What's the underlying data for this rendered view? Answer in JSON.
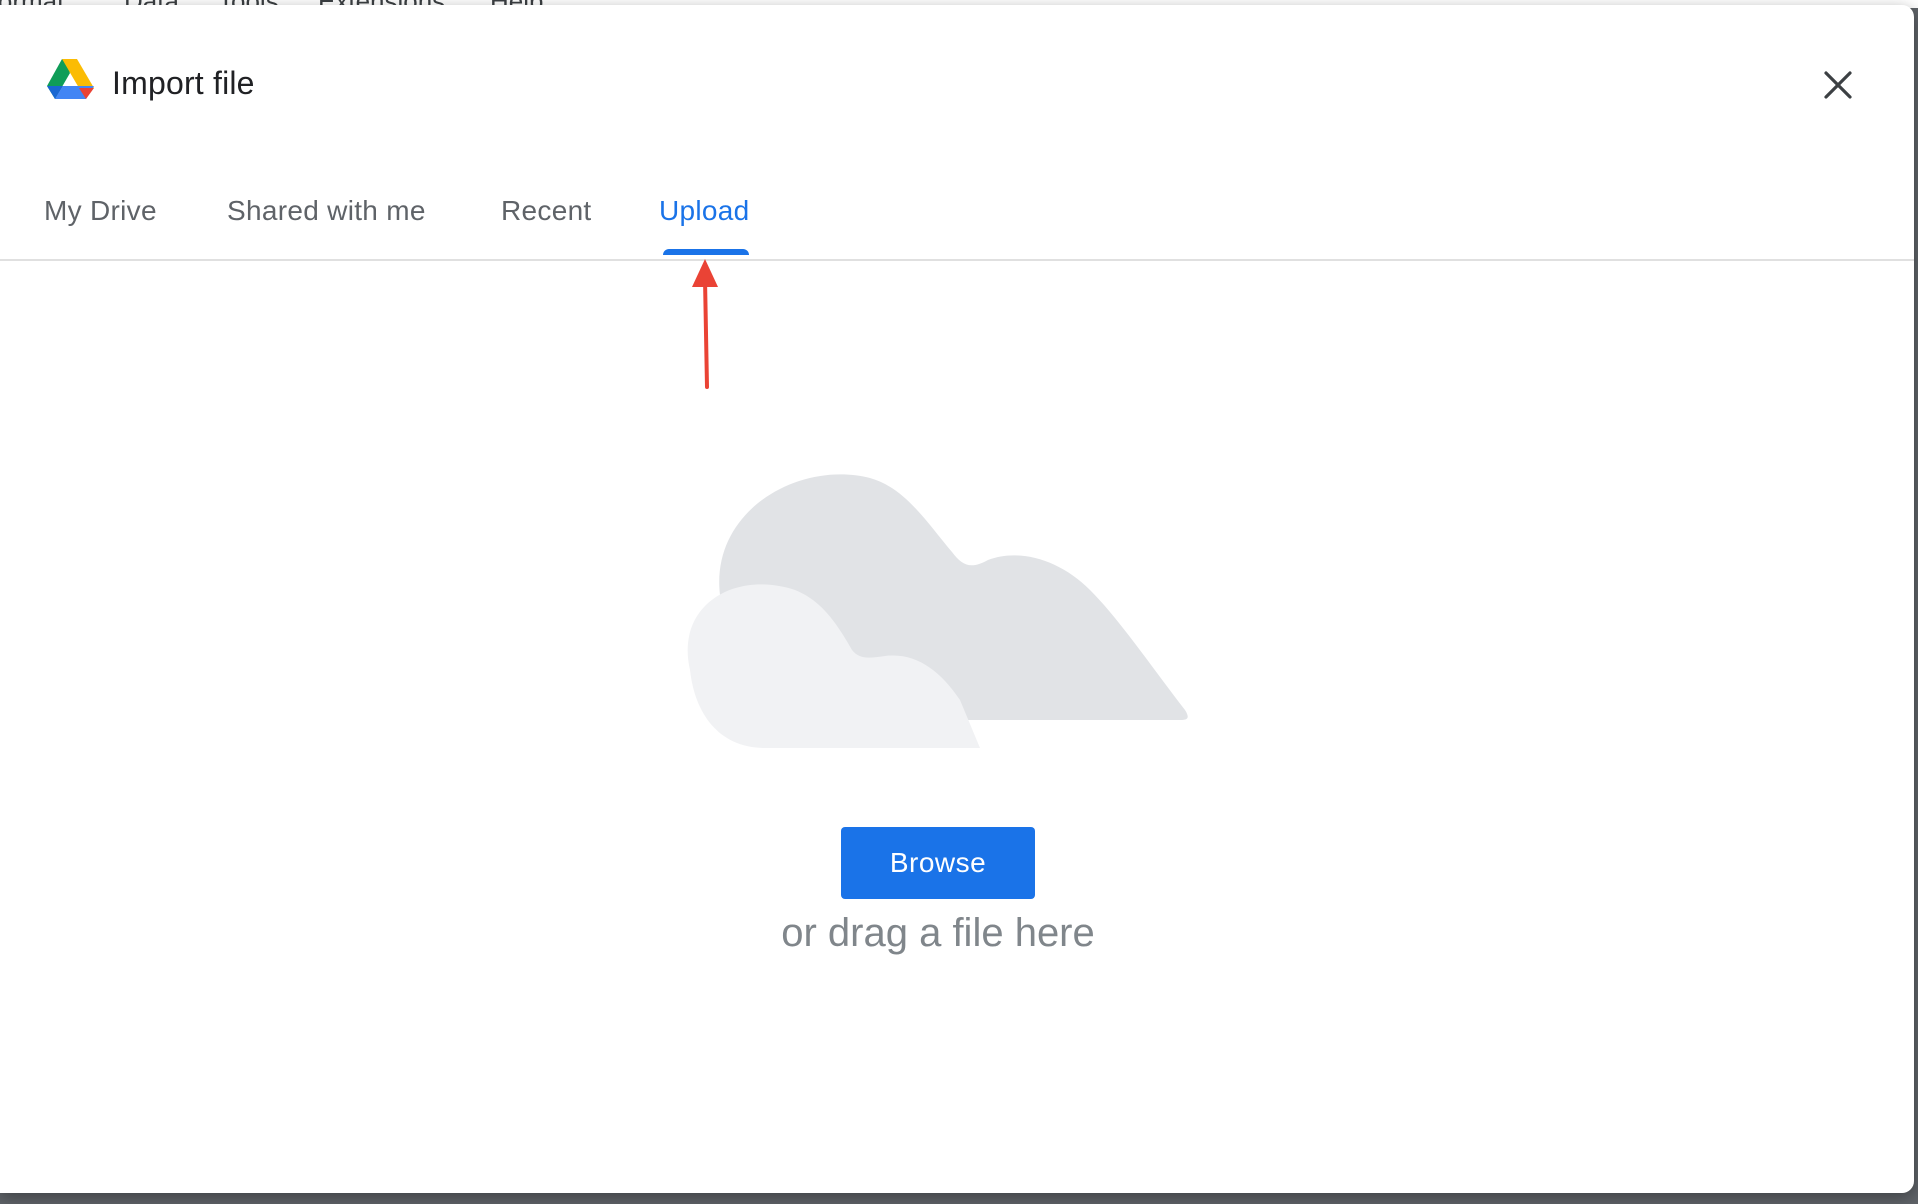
{
  "menubar": {
    "items": [
      "Format",
      "Data",
      "Tools",
      "Extensions",
      "Help"
    ]
  },
  "dialog": {
    "title": "Import file",
    "logo_icon": "google-drive-logo",
    "close_icon": "close-icon"
  },
  "tabs": [
    {
      "label": "My Drive",
      "active": false
    },
    {
      "label": "Shared with me",
      "active": false
    },
    {
      "label": "Recent",
      "active": false
    },
    {
      "label": "Upload",
      "active": true
    }
  ],
  "upload": {
    "illustration_icon": "cloud-icon",
    "browse_label": "Browse",
    "drag_text": "or drag a file here"
  },
  "colors": {
    "accent": "#1a73e8",
    "annotation": "#ea4335",
    "cloud_back": "#e1e3e6",
    "cloud_front": "#f1f2f4"
  }
}
